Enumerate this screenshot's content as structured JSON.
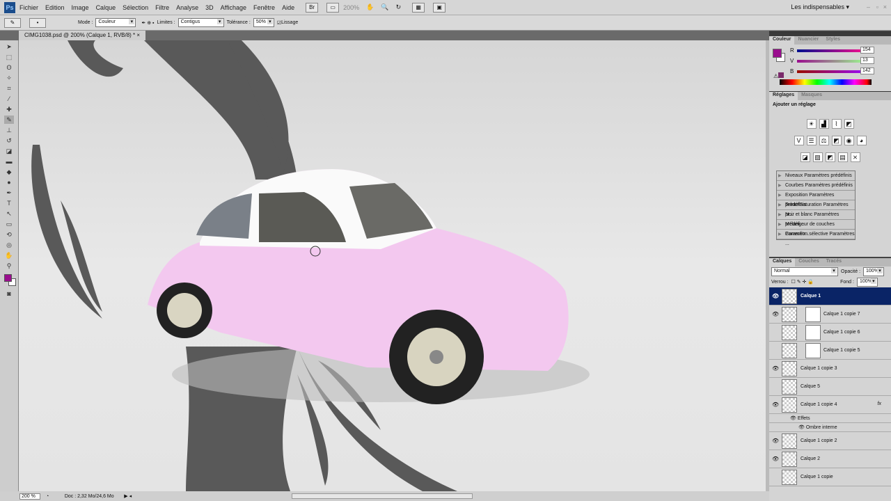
{
  "app": {
    "logo": "Ps",
    "workspace": "Les indispensables",
    "zoom_dropdown": "200%"
  },
  "menu": [
    "Fichier",
    "Edition",
    "Image",
    "Calque",
    "Sélection",
    "Filtre",
    "Analyse",
    "3D",
    "Affichage",
    "Fenêtre",
    "Aide"
  ],
  "options": {
    "mode_label": "Mode :",
    "mode_value": "Couleur",
    "limits_label": "Limites :",
    "limits_value": "Contigus",
    "tolerance_label": "Tolérance :",
    "tolerance_value": "50%",
    "smoothing_label": "Lissage",
    "smoothing_checked": true
  },
  "document": {
    "tab_title": "CIMG1038.psd @ 200% (Calque 1, RVB/8) *",
    "close": "×"
  },
  "status": {
    "zoom": "200 %",
    "doc_info": "Doc : 2,32 Mo/24,6 Mo"
  },
  "color_panel": {
    "tabs": [
      "Couleur",
      "Nuancier",
      "Styles"
    ],
    "channels": [
      {
        "label": "R",
        "value": "154"
      },
      {
        "label": "V",
        "value": "13"
      },
      {
        "label": "B",
        "value": "142"
      }
    ],
    "foreground": "#9a0d8e",
    "background": "#ffffff"
  },
  "adjust_panel": {
    "tabs": [
      "Réglages",
      "Masques"
    ],
    "title": "Ajouter un réglage",
    "presets": [
      "Niveaux Paramètres prédéfinis",
      "Courbes Paramètres prédéfinis",
      "Exposition Paramètres prédéfinis",
      "Teinte/Saturation Paramètres pr...",
      "Noir et blanc Paramètres prédéfi...",
      "Mélangeur de couches Paramètr...",
      "Correction sélective Paramètres ..."
    ]
  },
  "layers_panel": {
    "tabs": [
      "Calques",
      "Couches",
      "Tracés"
    ],
    "blend_mode": "Normal",
    "opacity_label": "Opacité :",
    "opacity": "100%",
    "lock_label": "Verrou :",
    "fill_label": "Fond :",
    "fill": "100%",
    "layers": [
      {
        "name": "Calque 1",
        "visible": true,
        "selected": true
      },
      {
        "name": "Calque 1 copie 7",
        "visible": true,
        "mask": true
      },
      {
        "name": "Calque 1 copie 6",
        "visible": false,
        "mask": true
      },
      {
        "name": "Calque 1 copie 5",
        "visible": false,
        "mask": true
      },
      {
        "name": "Calque 1 copie 3",
        "visible": true
      },
      {
        "name": "Calque 5",
        "visible": false
      },
      {
        "name": "Calque 1 copie 4",
        "visible": true,
        "fx": "fx"
      },
      {
        "name": "Calque 1 copie 2",
        "visible": true
      },
      {
        "name": "Calque 2",
        "visible": true
      },
      {
        "name": "Calque 1 copie",
        "visible": false
      }
    ],
    "effects_label": "Effets",
    "effect": "Ombre interne"
  }
}
